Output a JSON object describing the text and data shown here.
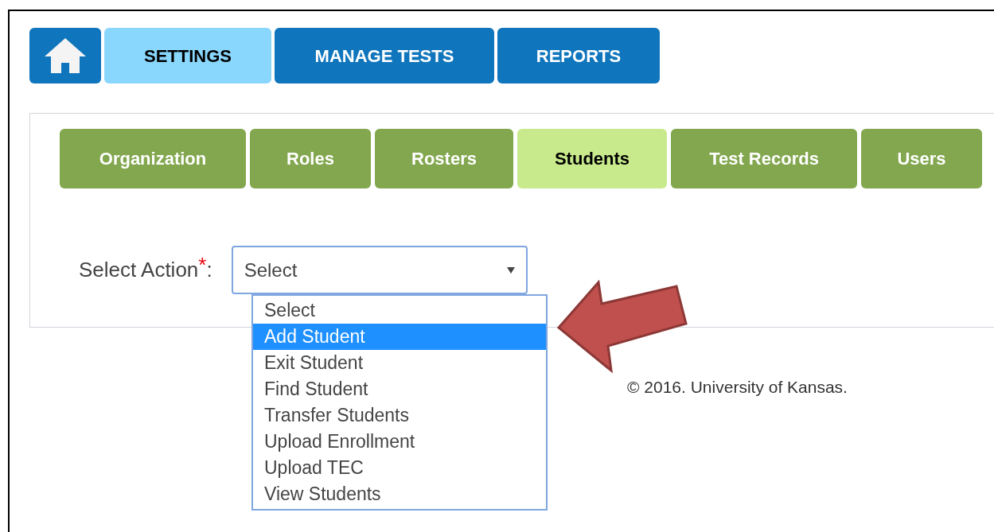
{
  "main_nav": [
    {
      "kind": "home",
      "selected": false
    },
    {
      "kind": "text",
      "label": "SETTINGS",
      "selected": true
    },
    {
      "kind": "text",
      "label": "MANAGE TESTS",
      "selected": false
    },
    {
      "kind": "text",
      "label": "REPORTS",
      "selected": false
    }
  ],
  "sub_tabs": [
    {
      "label": "Organization",
      "selected": false
    },
    {
      "label": "Roles",
      "selected": false
    },
    {
      "label": "Rosters",
      "selected": false
    },
    {
      "label": "Students",
      "selected": true
    },
    {
      "label": "Test Records",
      "selected": false
    },
    {
      "label": "Users",
      "selected": false
    }
  ],
  "action_field": {
    "label": "Select Action$^{*}$:",
    "value": "Select",
    "expanded": true,
    "options": [
      {
        "label": "Select",
        "highlighted": false
      },
      {
        "label": "Add Student",
        "highlighted": true
      },
      {
        "label": "Exit Student",
        "highlighted": false
      },
      {
        "label": "Find Student",
        "highlighted": false
      },
      {
        "label": "Transfer Students",
        "highlighted": false
      },
      {
        "label": "Upload Enrollment",
        "highlighted": false
      },
      {
        "label": "Upload TEC",
        "highlighted": false
      },
      {
        "label": "View Students",
        "highlighted": false
      }
    ]
  },
  "footer": {
    "copyright": "© 2016. University of Kansas."
  }
}
